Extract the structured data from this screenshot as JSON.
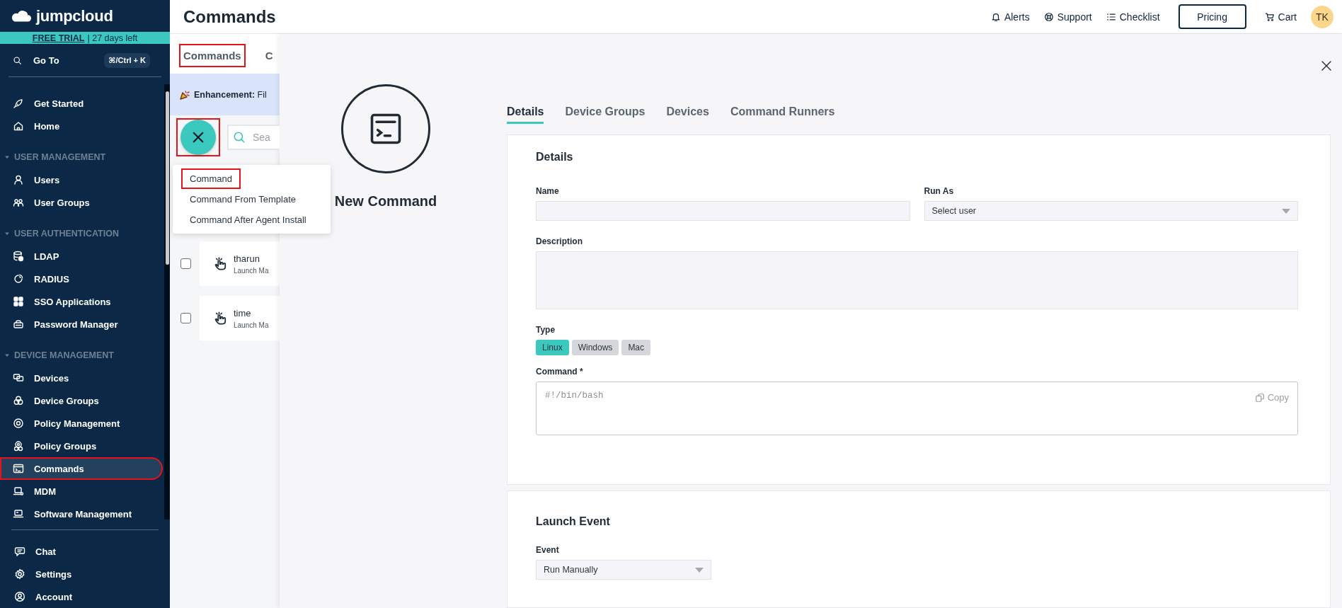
{
  "sidebar": {
    "logo": "jumpcloud",
    "trial": {
      "link": "FREE TRIAL",
      "text": "| 27 days left"
    },
    "goto": {
      "label": "Go To",
      "shortcut": "⌘/Ctrl + K"
    },
    "sections": [
      {
        "items": [
          {
            "label": "Get Started",
            "selected": false,
            "highlighted": false
          },
          {
            "label": "Home",
            "selected": false,
            "highlighted": false
          }
        ]
      },
      {
        "title": "USER MANAGEMENT",
        "expanded": true,
        "items": [
          {
            "label": "Users",
            "selected": false,
            "highlighted": false
          },
          {
            "label": "User Groups",
            "selected": false,
            "highlighted": false
          }
        ]
      },
      {
        "title": "USER AUTHENTICATION",
        "expanded": true,
        "items": [
          {
            "label": "LDAP",
            "selected": false,
            "highlighted": false
          },
          {
            "label": "RADIUS",
            "selected": false,
            "highlighted": false
          },
          {
            "label": "SSO Applications",
            "selected": false,
            "highlighted": false
          },
          {
            "label": "Password Manager",
            "selected": false,
            "highlighted": false
          }
        ]
      },
      {
        "title": "DEVICE MANAGEMENT",
        "expanded": true,
        "items": [
          {
            "label": "Devices",
            "selected": false,
            "highlighted": false
          },
          {
            "label": "Device Groups",
            "selected": false,
            "highlighted": false
          },
          {
            "label": "Policy Management",
            "selected": false,
            "highlighted": false
          },
          {
            "label": "Policy Groups",
            "selected": false,
            "highlighted": false
          },
          {
            "label": "Commands",
            "selected": true,
            "highlighted": true
          },
          {
            "label": "MDM",
            "selected": false,
            "highlighted": false
          },
          {
            "label": "Software Management",
            "selected": false,
            "highlighted": false
          }
        ]
      }
    ],
    "bottom_items": [
      {
        "label": "Chat"
      },
      {
        "label": "Settings"
      },
      {
        "label": "Account"
      }
    ]
  },
  "header": {
    "title": "Commands",
    "actions": [
      {
        "label": "Alerts"
      },
      {
        "label": "Support"
      },
      {
        "label": "Checklist"
      }
    ],
    "pricing": "Pricing",
    "cart": "Cart",
    "avatar": "TK"
  },
  "list_page": {
    "tabs": [
      {
        "label": "Commands",
        "highlighted": true
      },
      {
        "label": "C",
        "highlighted": false
      }
    ],
    "banner": "**Enhancement:** Fil",
    "add_button": {
      "open": true,
      "highlighted": true
    },
    "search": {
      "placeholder": "Sea"
    },
    "add_menu": [
      {
        "label": "Command",
        "highlighted": true
      },
      {
        "label": "Command From Template",
        "highlighted": false
      },
      {
        "label": "Command After Agent Install",
        "highlighted": false
      }
    ],
    "commands": [
      {
        "name": "tharun",
        "subtitle": "Launch Ma",
        "checked": false
      },
      {
        "name": "time",
        "subtitle": "Launch Ma",
        "checked": false
      }
    ]
  },
  "drawer": {
    "title": "New Command",
    "tabs": [
      {
        "label": "Details",
        "selected": true
      },
      {
        "label": "Device Groups",
        "selected": false
      },
      {
        "label": "Devices",
        "selected": false
      },
      {
        "label": "Command Runners",
        "selected": false
      }
    ],
    "details": {
      "heading": "Details",
      "name": {
        "label": "Name"
      },
      "run_as": {
        "label": "Run As",
        "value": "Select user"
      },
      "description": {
        "label": "Description"
      },
      "type": {
        "label": "Type",
        "options": [
          {
            "label": "Linux",
            "selected": true
          },
          {
            "label": "Windows",
            "selected": false
          },
          {
            "label": "Mac",
            "selected": false
          }
        ]
      },
      "command": {
        "label": "Command *",
        "placeholder": "#!/bin/bash",
        "copy": "Copy"
      }
    },
    "launch_event": {
      "heading": "Launch Event",
      "event": {
        "label": "Event",
        "value": "Run Manually"
      }
    }
  }
}
